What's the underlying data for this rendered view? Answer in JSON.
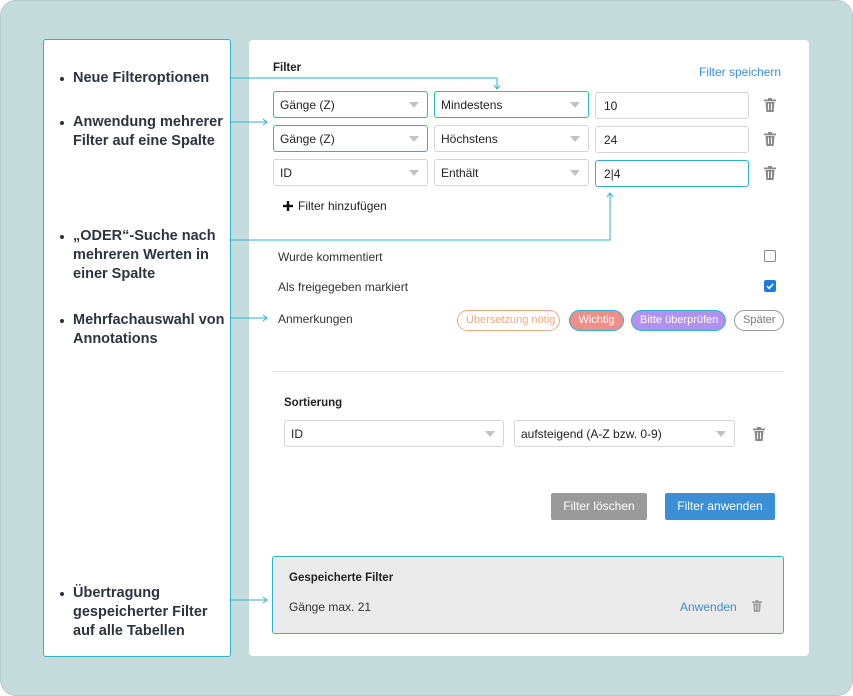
{
  "notes": [
    "Neue Filteroptionen",
    "Anwendung mehrerer Filter auf eine Spalte",
    "„ODER“-Suche nach mehreren Werten in einer Spalte",
    "Mehrfachauswahl von Annotations",
    "Übertragung gespeicherter Filter auf alle Tabellen"
  ],
  "filter": {
    "title": "Filter",
    "save_link": "Filter speichern",
    "rows": [
      {
        "column": "Gänge (Z)",
        "operator": "Mindestens",
        "value": "10"
      },
      {
        "column": "Gänge (Z)",
        "operator": "Höchstens",
        "value": "24"
      },
      {
        "column": "ID",
        "operator": "Enthält",
        "value": "2|4"
      }
    ],
    "add_label": "Filter hinzufügen",
    "commented_label": "Wurde kommentiert",
    "commented_checked": false,
    "released_label": "Als freigegeben markiert",
    "released_checked": true,
    "annotations_label": "Anmerkungen",
    "chips": [
      {
        "label": "Übersetzung nötig",
        "selected": false,
        "color": "#f2a97d"
      },
      {
        "label": "Wichtig",
        "selected": true,
        "color": "#ee8f8c"
      },
      {
        "label": "Bitte überprüfen",
        "selected": true,
        "color": "#b190f0"
      },
      {
        "label": "Später",
        "selected": false,
        "color": "#999999"
      }
    ]
  },
  "sort": {
    "title": "Sortierung",
    "column": "ID",
    "order": "aufsteigend (A-Z bzw. 0-9)"
  },
  "buttons": {
    "clear": "Filter löschen",
    "apply": "Filter anwenden"
  },
  "saved": {
    "title": "Gespeicherte Filter",
    "items": [
      {
        "name": "Gänge max. 21",
        "apply": "Anwenden"
      }
    ]
  },
  "colors": {
    "accent": "#2bb3cf",
    "link": "#3a8fd6",
    "apply_button": "#3a8fd6",
    "clear_button": "#9a9a9a",
    "frame_bg": "#c4dcdc"
  }
}
